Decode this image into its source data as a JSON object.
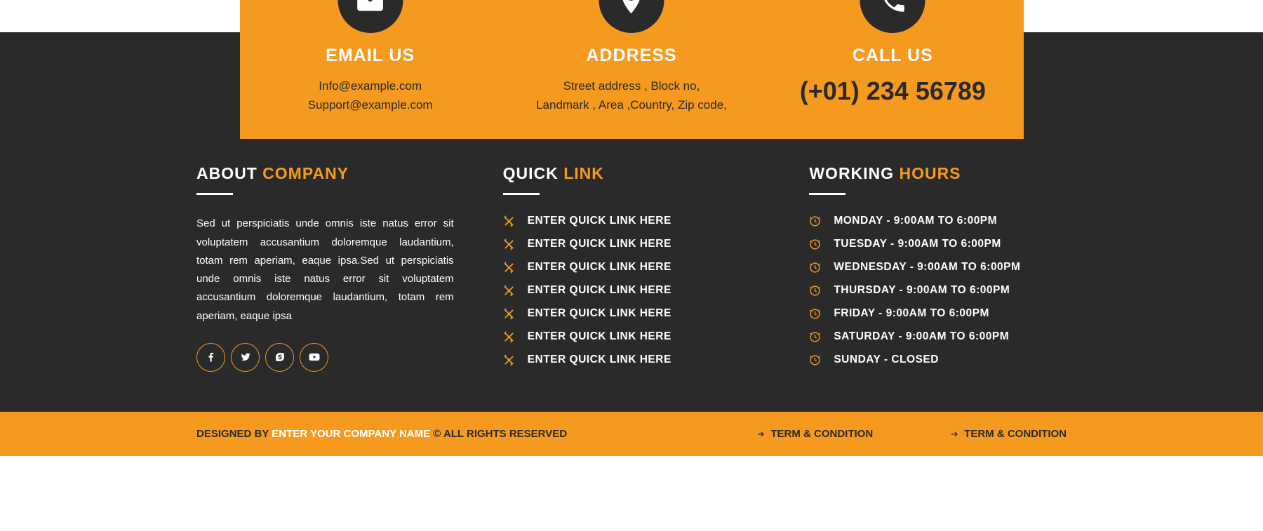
{
  "contact": {
    "email": {
      "title": "EMAIL US",
      "line1": "Info@example.com",
      "line2": "Support@example.com"
    },
    "address": {
      "title": "ADDRESS",
      "line1": "Street address , Block no,",
      "line2": "Landmark , Area ,Country, Zip code,"
    },
    "call": {
      "title": "CALL US",
      "number": "(+01) 234 56789"
    }
  },
  "about": {
    "heading_part1": "ABOUT",
    "heading_part2": "COMPANY",
    "text": "Sed ut perspiciatis unde omnis iste natus error sit voluptatem accusantium doloremque laudantium, totam rem aperiam, eaque ipsa.Sed ut perspiciatis unde omnis iste natus error sit voluptatem accusantium doloremque laudantium, totam rem aperiam, eaque ipsa"
  },
  "quick": {
    "heading_part1": "QUICK",
    "heading_part2": "LINK",
    "items": [
      "ENTER QUICK LINK HERE",
      "ENTER QUICK LINK HERE",
      "ENTER QUICK LINK HERE",
      "ENTER QUICK LINK HERE",
      "ENTER QUICK LINK HERE",
      "ENTER QUICK LINK HERE",
      "ENTER QUICK LINK HERE"
    ]
  },
  "hours": {
    "heading_part1": "WORKING",
    "heading_part2": "HOURS",
    "items": [
      "MONDAY - 9:00AM TO 6:00PM",
      "TUESDAY - 9:00AM TO 6:00PM",
      "WEDNESDAY - 9:00AM TO 6:00PM",
      "THURSDAY - 9:00AM TO 6:00PM",
      "FRIDAY - 9:00AM TO 6:00PM",
      "SATURDAY - 9:00AM TO 6:00PM",
      "SUNDAY - CLOSED"
    ]
  },
  "bottom": {
    "designed_prefix": "DESIGNED BY ",
    "company": "ENTER YOUR COMPANY NAME",
    "rights": " © ALL RIGHTS RESERVED",
    "term1": "TERM & CONDITION",
    "term2": "TERM & CONDITION"
  }
}
